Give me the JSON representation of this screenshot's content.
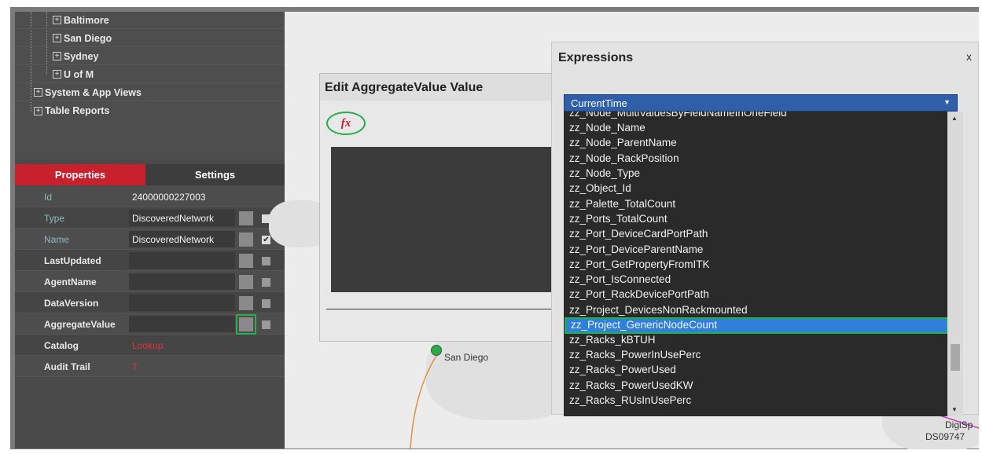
{
  "tree": {
    "items": [
      {
        "label": "Baltimore"
      },
      {
        "label": "San Diego"
      },
      {
        "label": "Sydney"
      },
      {
        "label": "U of M"
      },
      {
        "label": "System & App Views"
      },
      {
        "label": "Table Reports"
      }
    ]
  },
  "tabs": {
    "properties": "Properties",
    "settings": "Settings"
  },
  "properties": [
    {
      "label": "Id",
      "value": "24000000227003"
    },
    {
      "label": "Type",
      "value": "DiscoveredNetwork"
    },
    {
      "label": "Name",
      "value": "DiscoveredNetwork"
    },
    {
      "label": "LastUpdated",
      "value": ""
    },
    {
      "label": "AgentName",
      "value": ""
    },
    {
      "label": "DataVersion",
      "value": ""
    },
    {
      "label": "AggregateValue",
      "value": ""
    },
    {
      "label": "Catalog",
      "value": "Lookup"
    },
    {
      "label": "Audit Trail",
      "value": "T"
    }
  ],
  "edit_dialog": {
    "title": "Edit AggregateValue Value",
    "fx_label": "fx"
  },
  "expressions": {
    "title": "Expressions",
    "close": "x",
    "selected_value": "CurrentTime",
    "items": [
      "zz_Node_MultiValuesByFieldNameInOneField",
      "zz_Node_Name",
      "zz_Node_ParentName",
      "zz_Node_RackPosition",
      "zz_Node_Type",
      "zz_Object_Id",
      "zz_Palette_TotalCount",
      "zz_Ports_TotalCount",
      "zz_Port_DeviceCardPortPath",
      "zz_Port_DeviceParentName",
      "zz_Port_GetPropertyFromITK",
      "zz_Port_IsConnected",
      "zz_Port_RackDevicePortPath",
      "zz_Project_DevicesNonRackmounted",
      "zz_Project_GenericNodeCount",
      "zz_Racks_kBTUH",
      "zz_Racks_PowerInUsePerc",
      "zz_Racks_PowerUsed",
      "zz_Racks_PowerUsedKW",
      "zz_Racks_RUsInUsePerc"
    ],
    "highlighted": "zz_Project_GenericNodeCount"
  },
  "map": {
    "san_diego": "San Diego",
    "corner_1": "DigiSp",
    "corner_2": "DS09747"
  }
}
